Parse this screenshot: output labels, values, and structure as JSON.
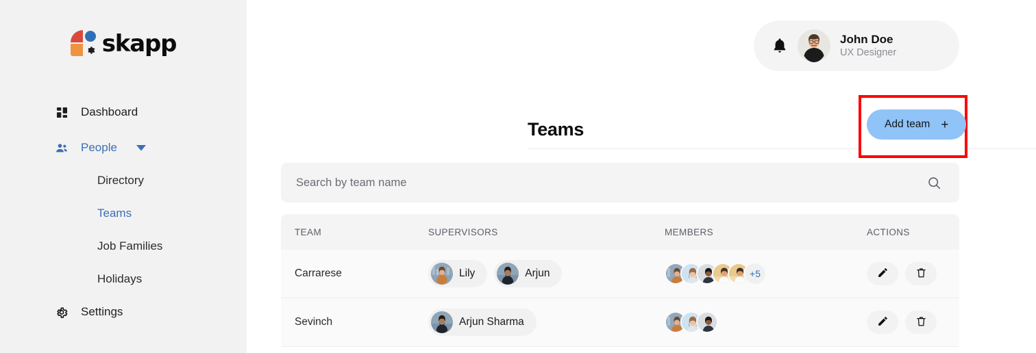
{
  "brand": {
    "name": "skapp",
    "logo_colors": {
      "red": "#d94a3d",
      "blue": "#2f6fb5",
      "orange": "#ef9343",
      "gear": "#1d1d1f"
    }
  },
  "sidebar": {
    "items": [
      {
        "label": "Dashboard",
        "icon": "grid-icon",
        "active": false
      },
      {
        "label": "People",
        "icon": "people-icon",
        "active": true,
        "expanded": true,
        "chevron": "chevron-down-icon"
      },
      {
        "label": "Settings",
        "icon": "gear-icon",
        "active": false
      }
    ],
    "subitems": [
      {
        "label": "Directory",
        "active": false
      },
      {
        "label": "Teams",
        "active": true
      },
      {
        "label": "Job Families",
        "active": false
      },
      {
        "label": "Holidays",
        "active": false
      }
    ]
  },
  "header": {
    "bell_icon": "bell-icon",
    "user": {
      "name": "John Doe",
      "role": "UX Designer",
      "avatar": "avatar-john-doe"
    }
  },
  "page": {
    "title": "Teams",
    "add_button": {
      "label": "Add team",
      "plus": "+",
      "color": "#90c3f7"
    },
    "highlight": {
      "color": "#ff0000"
    }
  },
  "search": {
    "placeholder": "Search by team name",
    "value": "",
    "icon": "search-icon"
  },
  "table": {
    "columns": [
      "TEAM",
      "SUPERVISORS",
      "MEMBERS",
      "ACTIONS"
    ],
    "rows": [
      {
        "team": "Carrarese",
        "supervisors": [
          "Lily",
          "Arjun"
        ],
        "members_shown": 5,
        "members_more": "+5",
        "actions": [
          "edit-icon",
          "delete-icon"
        ]
      },
      {
        "team": "Sevinch",
        "supervisors": [
          "Arjun Sharma"
        ],
        "members_shown": 3,
        "members_more": "",
        "actions": [
          "edit-icon",
          "delete-icon"
        ]
      }
    ]
  }
}
